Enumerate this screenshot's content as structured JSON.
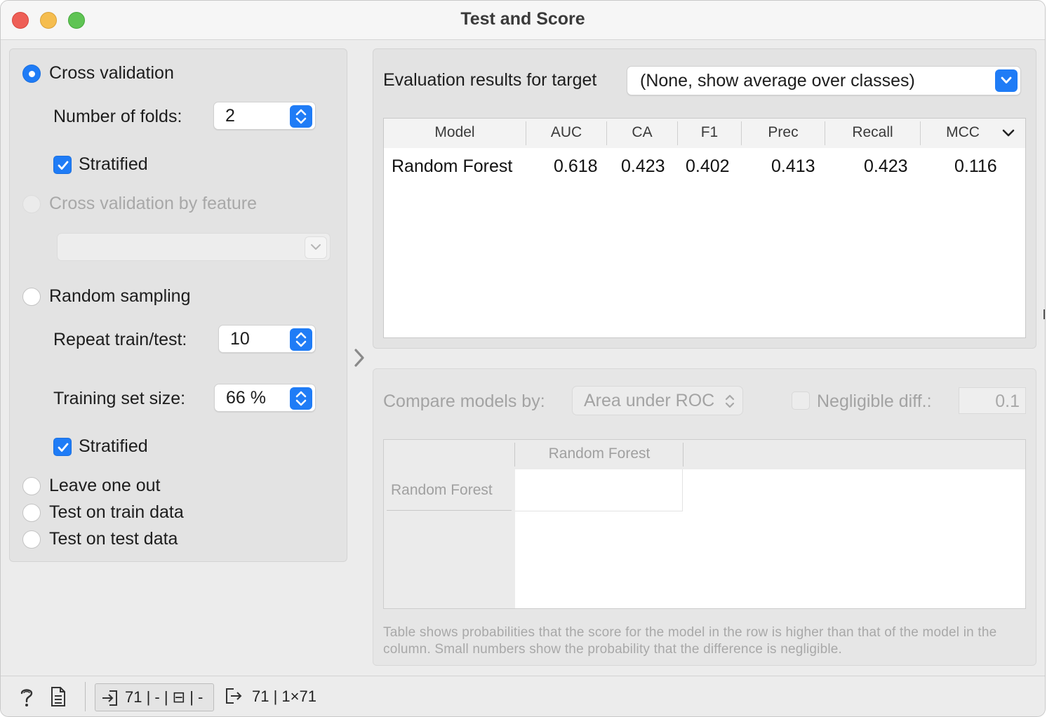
{
  "window": {
    "title": "Test and Score"
  },
  "sampling": {
    "cross_validation": {
      "label": "Cross validation",
      "selected": true
    },
    "folds_label": "Number of folds:",
    "folds_value": "2",
    "stratified_1": {
      "label": "Stratified",
      "checked": true
    },
    "cv_by_feature": {
      "label": "Cross validation by feature",
      "enabled": false
    },
    "feature_value": "",
    "random_sampling": {
      "label": "Random sampling",
      "selected": false
    },
    "repeat_label": "Repeat train/test:",
    "repeat_value": "10",
    "training_size_label": "Training set size:",
    "training_size_value": "66 %",
    "stratified_2": {
      "label": "Stratified",
      "checked": true
    },
    "leave_one_out": {
      "label": "Leave one out",
      "selected": false
    },
    "test_on_train": {
      "label": "Test on train data",
      "selected": false
    },
    "test_on_test": {
      "label": "Test on test data",
      "selected": false
    }
  },
  "evaluation": {
    "target_label": "Evaluation results for target",
    "target_value": "(None, show average over classes)",
    "columns": [
      "Model",
      "AUC",
      "CA",
      "F1",
      "Prec",
      "Recall",
      "MCC"
    ],
    "rows": [
      [
        "Random Forest",
        "0.618",
        "0.423",
        "0.402",
        "0.413",
        "0.423",
        "0.116"
      ]
    ]
  },
  "comparison": {
    "compare_label": "Compare models by:",
    "compare_value": "Area under ROC",
    "negligible_label": "Negligible diff.:",
    "negligible_checked": false,
    "negligible_value": "0.1",
    "column_headers": [
      "Random Forest"
    ],
    "row_headers": [
      "Random Forest"
    ],
    "note": "Table shows probabilities that the score for the model in the row is higher than that of the model in the column. Small numbers show the probability that the difference is negligible."
  },
  "statusbar": {
    "input_summary": "71 | - | ⊟ | -",
    "output_summary": "71 | 1×71"
  },
  "colors": {
    "accent": "#1f7cf6",
    "window_bg": "#ececec",
    "panel_bg": "#e3e3e3",
    "disabled_text": "#a8a8a8"
  },
  "icons": [
    "help-icon",
    "report-icon",
    "input-icon",
    "output-icon",
    "stepper-icon",
    "chevron-down-icon",
    "chevron-right-icon",
    "checkmark-icon"
  ]
}
